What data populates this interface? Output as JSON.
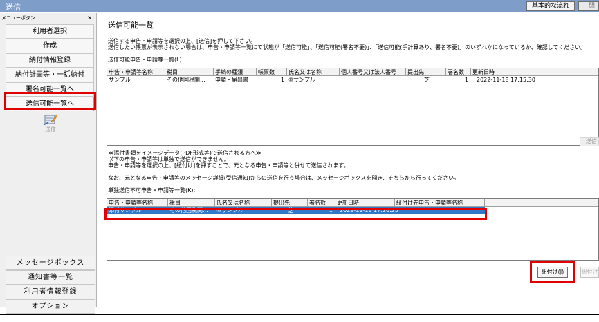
{
  "window": {
    "title": "送信",
    "flow_button": "基本的な流れ",
    "close_button": "閉じる"
  },
  "sidebar": {
    "header": "メニューボタン",
    "close_mark": "×|",
    "items": [
      {
        "label": "利用者選択"
      },
      {
        "label": "作成"
      },
      {
        "label": "納付情報登録"
      },
      {
        "label": "納付計画等・一括納付"
      },
      {
        "label": "署名可能一覧へ"
      },
      {
        "label": "送信可能一覧へ"
      }
    ],
    "icon_label": "送信",
    "bottom_items": [
      {
        "label": "メッセージボックス"
      },
      {
        "label": "通知書等一覧"
      },
      {
        "label": "利用者情報登録"
      },
      {
        "label": "オプション"
      }
    ]
  },
  "main": {
    "title": "送信可能一覧",
    "desc1": "送信する申告・申請等を選択の上、[送信]を押して下さい。",
    "desc2": "送信したい帳票が表示されない場合は、申告・申請等一覧にて状態が「送信可能」、「送信可能(署名不要)」、「送信可能(手計算あり、署名不要)」のいずれかになっているか、確認してください。",
    "list1_label": "送信可能申告・申請等一覧(L):",
    "list1": {
      "columns": [
        "申告・申請等名称",
        "税目",
        "手続の種類",
        "帳票数",
        "氏名又は名称",
        "個人番号又は法人番号",
        "提出先",
        "署名数",
        "更新日時"
      ],
      "rows": [
        {
          "name": "サンプル",
          "tax": "その他国税関...",
          "procedure": "申請・届出書",
          "forms": "1",
          "person": "⑩サンプル",
          "number": "",
          "office": "芝",
          "signs": "1",
          "updated": "2022-11-18 17:15:30"
        }
      ]
    },
    "note1": "≪添付書類をイメージデータ(PDF形式等)で送信される方へ≫",
    "note2": "以下の申告・申請等は単独で送信ができません。",
    "note3": "申告・申請等を選択の上、[紐付け]を押すことで、元となる申告・申請等と併せて送信されます。",
    "note4": "なお、元となる申告・申請等のメッセージ詳細(受信通知)からの送信を行う場合は、メッセージボックスを開き、そちらから行ってください。",
    "list2_label": "単独送信不可申告・申請等一覧(K):",
    "list2": {
      "columns": [
        "申告・申請等名称",
        "税目",
        "氏名又は名称",
        "提出先",
        "署名数",
        "更新日時",
        "紐付け先申告・申請等名称"
      ],
      "rows": [
        {
          "name": "添付サンプル",
          "tax": "その他国税関...",
          "person": "⑩サンプル",
          "office": "芝",
          "signs": "1",
          "updated": "2022-11-18 17:26:25",
          "target": ""
        }
      ]
    },
    "link_button": "紐付け(J)",
    "unlink_button": "紐付け解除",
    "side_button": "送信"
  },
  "colors": {
    "titlebar": "#7f9dc9",
    "selection": "#3078c8",
    "annotation_red": "#e00000"
  }
}
